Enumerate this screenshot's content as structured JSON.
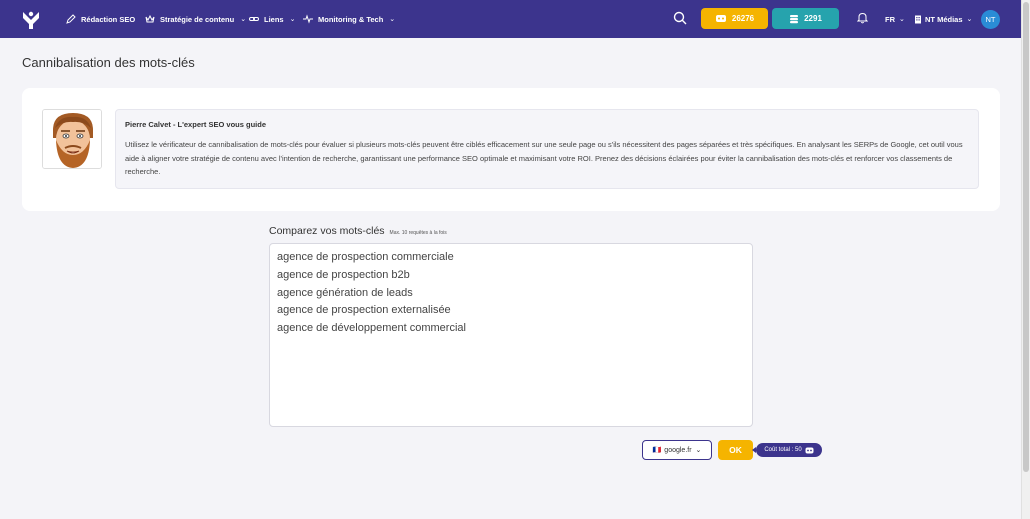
{
  "nav": {
    "items": [
      {
        "label": "Rédaction SEO",
        "icon": "pencil-icon",
        "has_dropdown": false
      },
      {
        "label": "Stratégie de contenu",
        "icon": "crown-icon",
        "has_dropdown": true
      },
      {
        "label": "Liens",
        "icon": "link-icon",
        "has_dropdown": true
      },
      {
        "label": "Monitoring & Tech",
        "icon": "pulse-icon",
        "has_dropdown": true
      }
    ],
    "credits_gold": "26276",
    "credits_teal": "2291",
    "language": "FR",
    "organization": "NT Médias",
    "avatar_initials": "NT",
    "chevron": "⌄"
  },
  "page": {
    "title": "Cannibalisation des mots-clés"
  },
  "expert": {
    "name": "Pierre Calvet - L'expert SEO vous guide",
    "text": "Utilisez le vérificateur de cannibalisation de mots-clés pour évaluer si plusieurs mots-clés peuvent être ciblés efficacement sur une seule page ou s'ils nécessitent des pages séparées et très spécifiques. En analysant les SERPs de Google, cet outil vous aide à aligner votre stratégie de contenu avec l'intention de recherche, garantissant une performance SEO optimale et maximisant votre ROI. Prenez des décisions éclairées pour éviter la cannibalisation des mots-clés et renforcer vos classements de recherche."
  },
  "compare": {
    "label": "Comparez vos mots-clés",
    "hint": "Max. 10 requêtes à la fois",
    "keywords": "agence de prospection commerciale\nagence de prospection b2b\nagence génération de leads\nagence de prospection externalisée\nagence de développement commercial",
    "engine": "google.fr",
    "engine_flag": "🇫🇷",
    "ok_label": "OK",
    "cost": "Coût total : 50"
  },
  "colors": {
    "brand": "#3c348d",
    "gold": "#f5b400",
    "teal": "#26a3ad"
  }
}
